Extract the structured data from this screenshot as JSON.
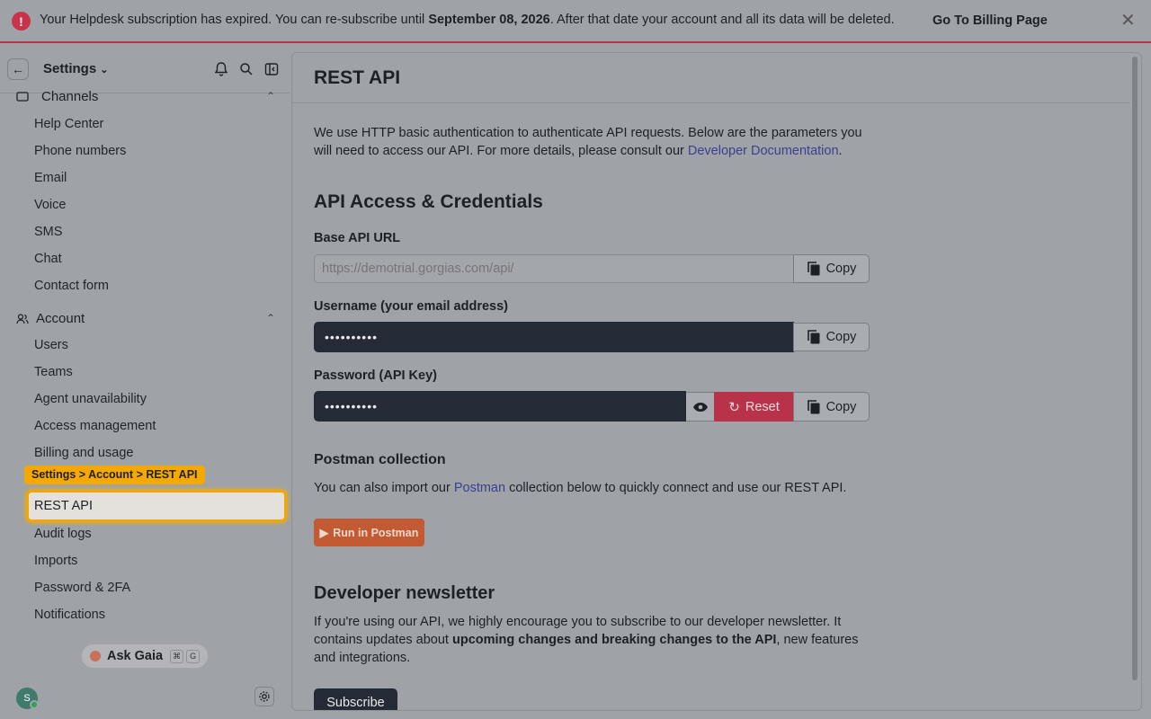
{
  "banner": {
    "text_before": "Your Helpdesk subscription has expired. You can re-subscribe until ",
    "date": "September 08, 2026",
    "text_after": ". After that date your account and all its data will be deleted.",
    "link": "Go To Billing Page"
  },
  "sidebar": {
    "title": "Settings",
    "channels_label": "Channels",
    "channels_items": [
      "Help Center",
      "Phone numbers",
      "Email",
      "Voice",
      "SMS",
      "Chat",
      "Contact form"
    ],
    "account_label": "Account",
    "account_items_before": [
      "Users",
      "Teams",
      "Agent unavailability",
      "Access management",
      "Billing and usage"
    ],
    "active_item": "REST API",
    "account_items_after": [
      "Audit logs",
      "Imports",
      "Password & 2FA",
      "Notifications"
    ],
    "breadcrumb_tag": "Settings > Account > REST API",
    "ask_gaia": "Ask Gaia",
    "kbd1": "⌘",
    "kbd2": "G",
    "avatar_initial": "S"
  },
  "main": {
    "title": "REST API",
    "intro_1": "We use HTTP basic authentication to authenticate API requests. Below are the parameters you will need to access our API. For more details, please consult our ",
    "intro_link": "Developer Documentation",
    "intro_end": ".",
    "credentials_heading": "API Access & Credentials",
    "base_url_label": "Base API URL",
    "base_url_value": "https://demotrial.gorgias.com/api/",
    "username_label": "Username (your email address)",
    "username_value": "••••••••••",
    "password_label": "Password (API Key)",
    "password_value": "••••••••••",
    "copy_label": "Copy",
    "reset_label": "Reset",
    "postman_heading": "Postman collection",
    "postman_text_1": "You can also import our ",
    "postman_link": "Postman",
    "postman_text_2": " collection below to quickly connect and use our REST API.",
    "postman_button": "Run in Postman",
    "newsletter_heading": "Developer newsletter",
    "newsletter_text_1": "If you're using our API, we highly encourage you to subscribe to our developer newsletter. It contains updates about ",
    "newsletter_bold": "upcoming changes and breaking changes to the API",
    "newsletter_text_2": ", new features and integrations.",
    "subscribe_button": "Subscribe"
  },
  "colors": {
    "accent_highlight": "#f5a500",
    "danger": "#b8334a",
    "postman": "#c25a33",
    "dark_input": "#242a36"
  }
}
